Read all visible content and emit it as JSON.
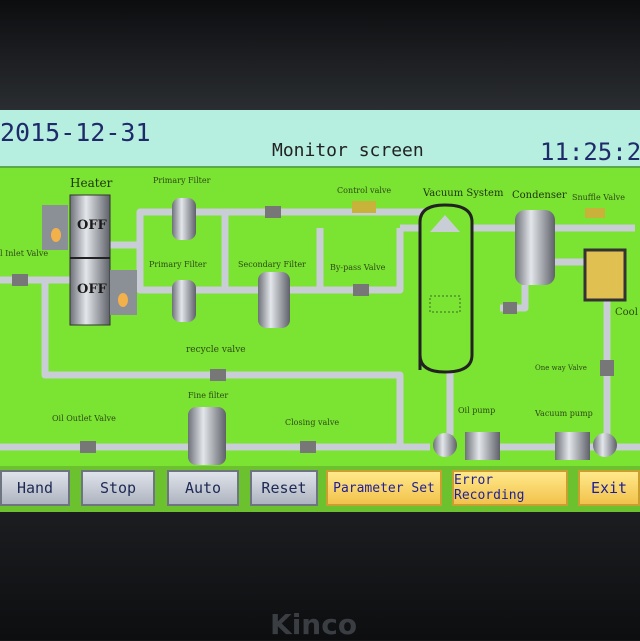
{
  "header": {
    "date": "2015-12-31",
    "title": "Monitor screen",
    "time": "11:25:2"
  },
  "diagram": {
    "labels": {
      "heater": "Heater",
      "primary_filter_1": "Primary Filter",
      "primary_filter_2": "Primary Filter",
      "secondary_filter": "Secondary Filter",
      "bypass_valve": "By-pass Valve",
      "control_valve": "Control valve",
      "vacuum_system": "Vacuum System",
      "condenser": "Condenser",
      "snuffle_valve": "Snuffle Valve",
      "inlet_valve": "l Inlet Valve",
      "cool": "Cool",
      "recycle_valve": "recycle valve",
      "one_way_valve": "One way Valve",
      "fine_filter": "Fine filter",
      "oil_outlet_valve": "Oil Outlet Valve",
      "closing_valve": "Closing valve",
      "oil_pump": "Oil pump",
      "vacuum_pump": "Vacuum pump"
    },
    "heater_status_1": "OFF",
    "heater_status_2": "OFF"
  },
  "buttons": {
    "hand": "Hand",
    "stop": "Stop",
    "auto": "Auto",
    "reset": "Reset",
    "parameter_set": "Parameter Set",
    "error_recording": "Error Recording",
    "exit": "Exit"
  },
  "logo": "Kinco",
  "colors": {
    "screen": "#7be331",
    "header": "#b6eee0",
    "gray_button": "#c4c9d2",
    "yellow_button": "#f6d266"
  }
}
